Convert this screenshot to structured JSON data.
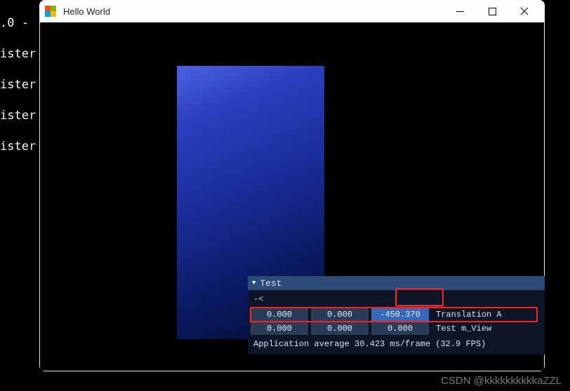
{
  "terminal": {
    "line1": ".0 -",
    "line2": "ister",
    "line3": "ister",
    "line4": "ister",
    "line5": "ister"
  },
  "window": {
    "title": "Hello World"
  },
  "imgui": {
    "title": "Test",
    "raw": "-<",
    "rowA": {
      "x": "0.000",
      "y": "0.000",
      "z": "-450.370",
      "label": "Translation A"
    },
    "rowB": {
      "x": "0.000",
      "y": "0.000",
      "z": "0.000",
      "label": "Test m_View"
    },
    "footer": "Application average 30.423 ms/frame (32.9 FPS)"
  },
  "watermark": "CSDN @kkkkkkkkkkaZZL"
}
